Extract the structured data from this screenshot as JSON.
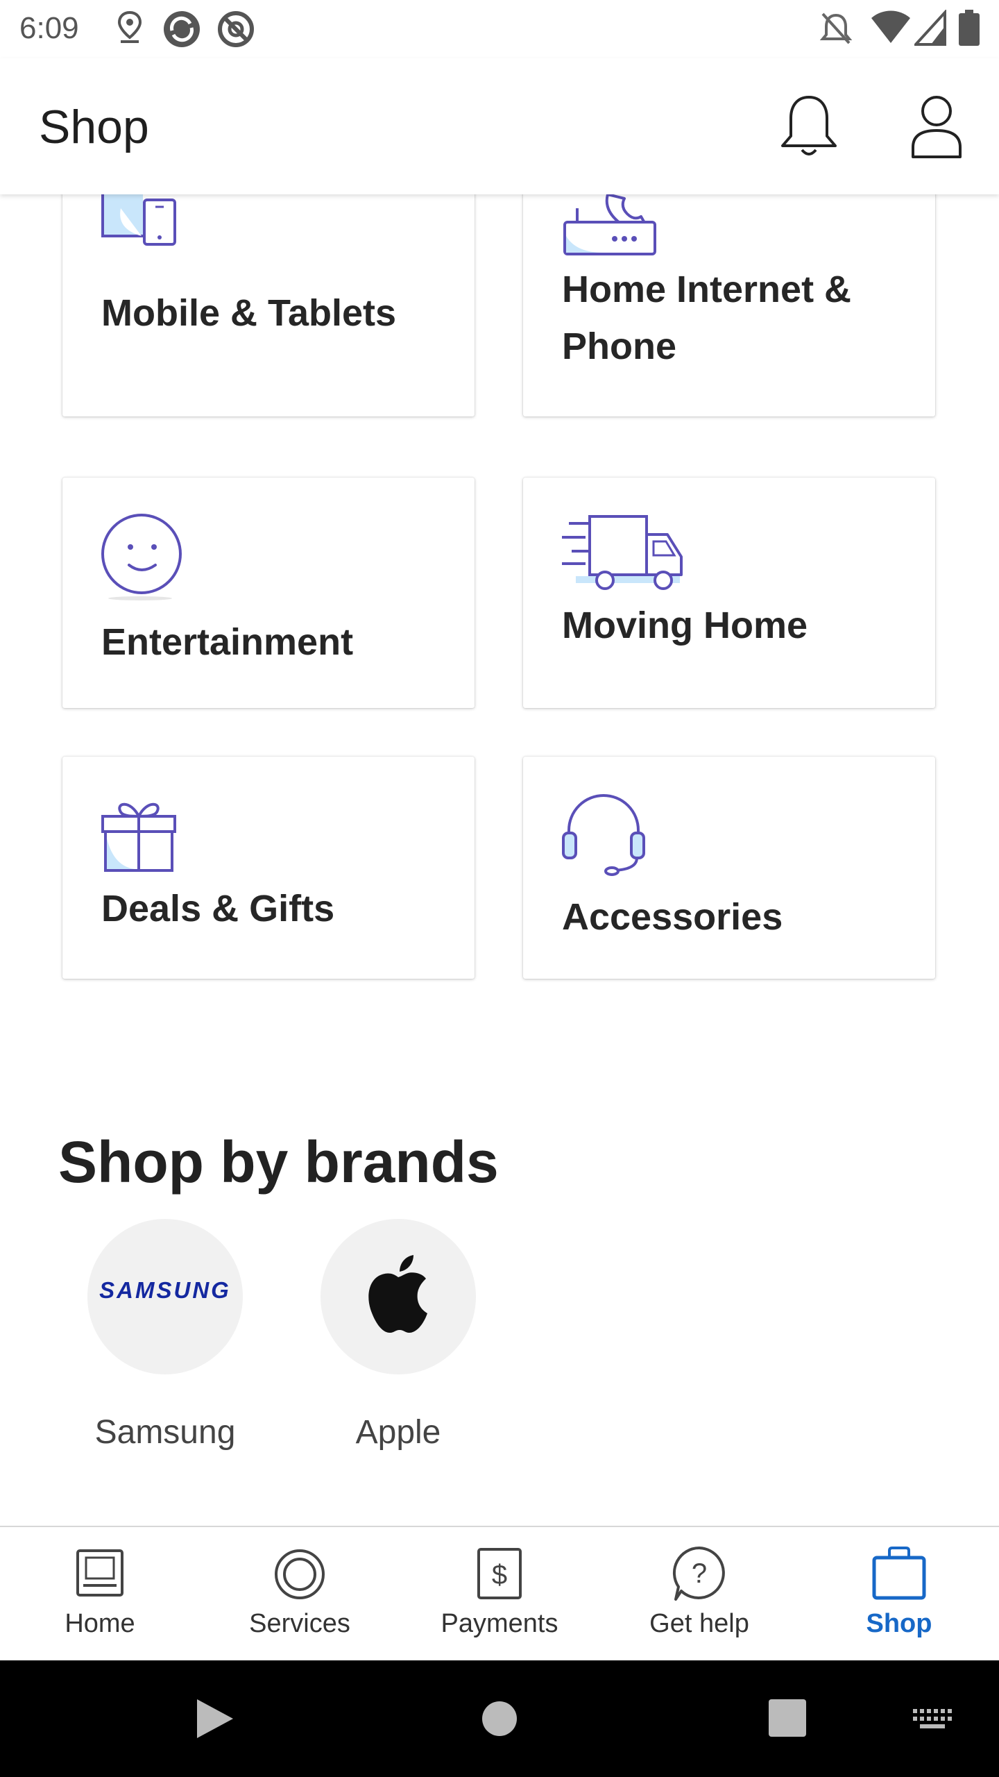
{
  "status_bar": {
    "time": "6:09"
  },
  "header": {
    "title": "Shop"
  },
  "categories": [
    {
      "label": "Mobile & Tablets",
      "icon": "mobile-tablet-icon"
    },
    {
      "label": "Home Internet & Phone",
      "icon": "router-phone-icon"
    },
    {
      "label": "Entertainment",
      "icon": "smiley-icon"
    },
    {
      "label": "Moving Home",
      "icon": "moving-truck-icon"
    },
    {
      "label": "Deals & Gifts",
      "icon": "gift-icon"
    },
    {
      "label": "Accessories",
      "icon": "headset-icon"
    }
  ],
  "brands_section": {
    "title": "Shop by brands",
    "brands": [
      {
        "name": "Samsung",
        "logo_text": "SAMSUNG"
      },
      {
        "name": "Apple"
      }
    ]
  },
  "bottom_nav": {
    "items": [
      {
        "label": "Home",
        "icon": "home-laptop-icon"
      },
      {
        "label": "Services",
        "icon": "services-ring-icon"
      },
      {
        "label": "Payments",
        "icon": "payments-dollar-icon"
      },
      {
        "label": "Get help",
        "icon": "help-question-icon"
      },
      {
        "label": "Shop",
        "icon": "shopping-bag-icon",
        "active": true
      }
    ]
  },
  "colors": {
    "accent": "#1768c7",
    "icon_stroke": "#5a4fb8",
    "icon_fill": "#c9e6fb",
    "samsung_blue": "#1428a0"
  }
}
